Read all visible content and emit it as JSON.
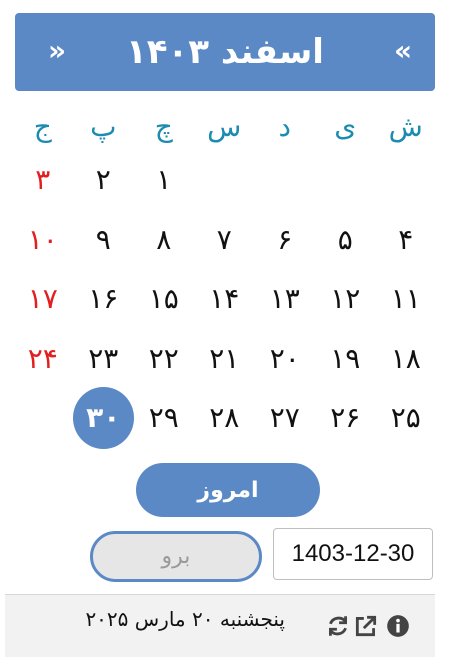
{
  "header": {
    "title": "اسفند ۱۴۰۳",
    "prev_label": "»",
    "next_label": "«"
  },
  "weekdays": [
    "ش",
    "ی",
    "د",
    "س",
    "چ",
    "پ",
    "ج"
  ],
  "weeks": [
    [
      "",
      "",
      "",
      "",
      "۱",
      "۲",
      "۳"
    ],
    [
      "۴",
      "۵",
      "۶",
      "۷",
      "۸",
      "۹",
      "۱۰"
    ],
    [
      "۱۱",
      "۱۲",
      "۱۳",
      "۱۴",
      "۱۵",
      "۱۶",
      "۱۷"
    ],
    [
      "۱۸",
      "۱۹",
      "۲۰",
      "۲۱",
      "۲۲",
      "۲۳",
      "۲۴"
    ],
    [
      "۲۵",
      "۲۶",
      "۲۷",
      "۲۸",
      "۲۹",
      "۳۰",
      ""
    ]
  ],
  "selected_day": "۳۰",
  "today_label": "امروز",
  "go_label": "برو",
  "date_input_value": "1403-12-30",
  "footer_text": "پنجشنبه ۲۰ مارس ۲۰۲۵",
  "icons": {
    "info": "info-icon",
    "external": "external-link-icon",
    "refresh": "refresh-icon"
  },
  "colors": {
    "accent": "#5b89c6",
    "weekday": "#1b8bb0",
    "holiday": "#e31e1e"
  }
}
